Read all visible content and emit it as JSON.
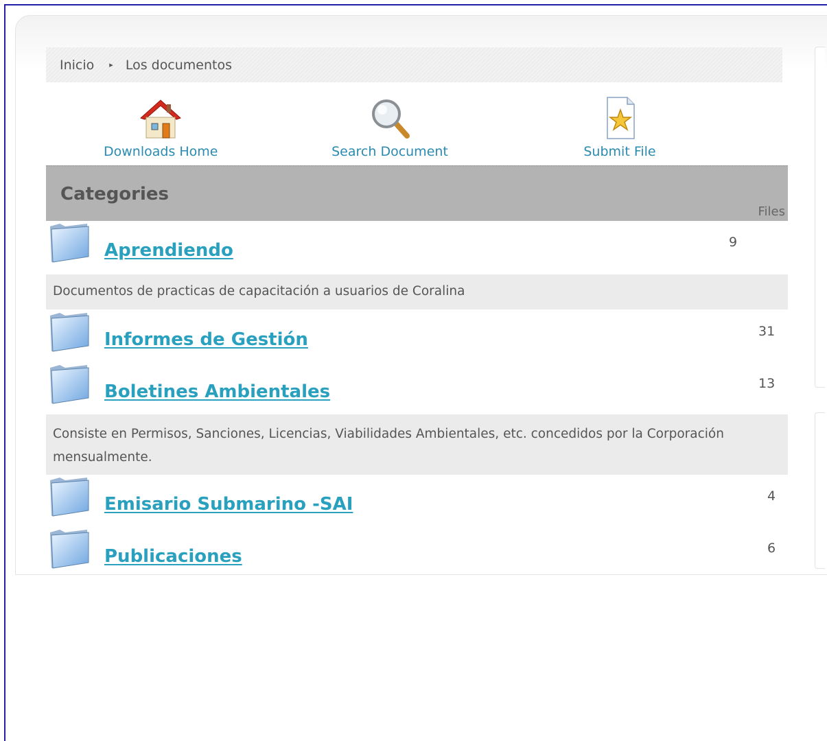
{
  "breadcrumb": {
    "home": "Inicio",
    "separator": "▸",
    "current": "Los documentos"
  },
  "toolbar": {
    "downloads_home": "Downloads Home",
    "search_document": "Search Document",
    "submit_file": "Submit File"
  },
  "categories": {
    "title": "Categories",
    "files_label": "Files",
    "items": [
      {
        "name": "Aprendiendo",
        "count": "9",
        "description": "Documentos de practicas de capacitación a usuarios de Coralina"
      },
      {
        "name": "Informes de Gestión",
        "count": "31",
        "description": ""
      },
      {
        "name": "Boletines Ambientales",
        "count": "13",
        "description": "Consiste en Permisos, Sanciones, Licencias, Viabilidades Ambientales, etc. concedidos por la Corporación mensualmente."
      },
      {
        "name": "Emisario Submarino -SAI",
        "count": "4",
        "description": ""
      },
      {
        "name": "Publicaciones",
        "count": "6",
        "description": ""
      }
    ]
  },
  "colors": {
    "link": "#2aa0bf",
    "header_bg": "#b3b3b3",
    "frame_border": "#1f1fa8"
  }
}
